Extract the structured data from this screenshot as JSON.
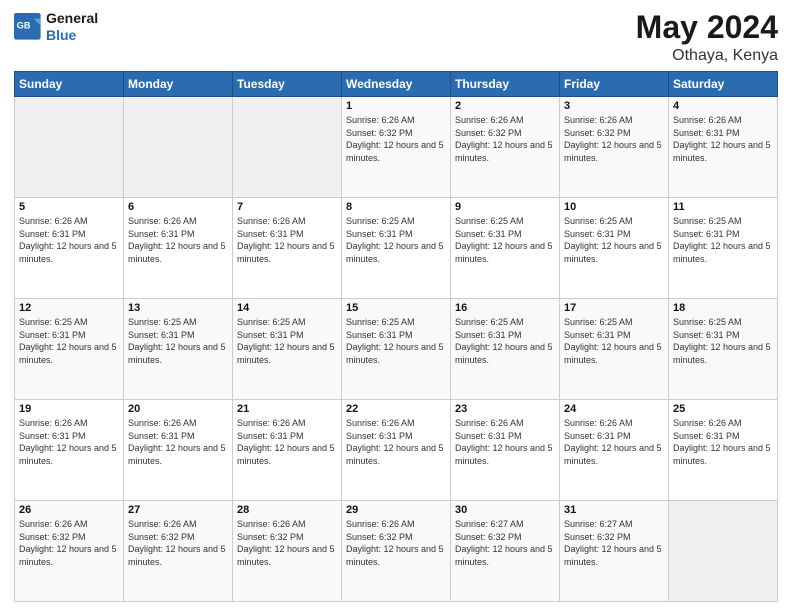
{
  "logo": {
    "text_general": "General",
    "text_blue": "Blue"
  },
  "header": {
    "title": "May 2024",
    "subtitle": "Othaya, Kenya"
  },
  "days_of_week": [
    "Sunday",
    "Monday",
    "Tuesday",
    "Wednesday",
    "Thursday",
    "Friday",
    "Saturday"
  ],
  "weeks": [
    {
      "days": [
        {
          "number": "",
          "empty": true
        },
        {
          "number": "",
          "empty": true
        },
        {
          "number": "",
          "empty": true
        },
        {
          "number": "1",
          "sunrise": "6:26 AM",
          "sunset": "6:32 PM",
          "daylight": "12 hours and 5 minutes."
        },
        {
          "number": "2",
          "sunrise": "6:26 AM",
          "sunset": "6:32 PM",
          "daylight": "12 hours and 5 minutes."
        },
        {
          "number": "3",
          "sunrise": "6:26 AM",
          "sunset": "6:32 PM",
          "daylight": "12 hours and 5 minutes."
        },
        {
          "number": "4",
          "sunrise": "6:26 AM",
          "sunset": "6:31 PM",
          "daylight": "12 hours and 5 minutes."
        }
      ]
    },
    {
      "days": [
        {
          "number": "5",
          "sunrise": "6:26 AM",
          "sunset": "6:31 PM",
          "daylight": "12 hours and 5 minutes."
        },
        {
          "number": "6",
          "sunrise": "6:26 AM",
          "sunset": "6:31 PM",
          "daylight": "12 hours and 5 minutes."
        },
        {
          "number": "7",
          "sunrise": "6:26 AM",
          "sunset": "6:31 PM",
          "daylight": "12 hours and 5 minutes."
        },
        {
          "number": "8",
          "sunrise": "6:25 AM",
          "sunset": "6:31 PM",
          "daylight": "12 hours and 5 minutes."
        },
        {
          "number": "9",
          "sunrise": "6:25 AM",
          "sunset": "6:31 PM",
          "daylight": "12 hours and 5 minutes."
        },
        {
          "number": "10",
          "sunrise": "6:25 AM",
          "sunset": "6:31 PM",
          "daylight": "12 hours and 5 minutes."
        },
        {
          "number": "11",
          "sunrise": "6:25 AM",
          "sunset": "6:31 PM",
          "daylight": "12 hours and 5 minutes."
        }
      ]
    },
    {
      "days": [
        {
          "number": "12",
          "sunrise": "6:25 AM",
          "sunset": "6:31 PM",
          "daylight": "12 hours and 5 minutes."
        },
        {
          "number": "13",
          "sunrise": "6:25 AM",
          "sunset": "6:31 PM",
          "daylight": "12 hours and 5 minutes."
        },
        {
          "number": "14",
          "sunrise": "6:25 AM",
          "sunset": "6:31 PM",
          "daylight": "12 hours and 5 minutes."
        },
        {
          "number": "15",
          "sunrise": "6:25 AM",
          "sunset": "6:31 PM",
          "daylight": "12 hours and 5 minutes."
        },
        {
          "number": "16",
          "sunrise": "6:25 AM",
          "sunset": "6:31 PM",
          "daylight": "12 hours and 5 minutes."
        },
        {
          "number": "17",
          "sunrise": "6:25 AM",
          "sunset": "6:31 PM",
          "daylight": "12 hours and 5 minutes."
        },
        {
          "number": "18",
          "sunrise": "6:25 AM",
          "sunset": "6:31 PM",
          "daylight": "12 hours and 5 minutes."
        }
      ]
    },
    {
      "days": [
        {
          "number": "19",
          "sunrise": "6:26 AM",
          "sunset": "6:31 PM",
          "daylight": "12 hours and 5 minutes."
        },
        {
          "number": "20",
          "sunrise": "6:26 AM",
          "sunset": "6:31 PM",
          "daylight": "12 hours and 5 minutes."
        },
        {
          "number": "21",
          "sunrise": "6:26 AM",
          "sunset": "6:31 PM",
          "daylight": "12 hours and 5 minutes."
        },
        {
          "number": "22",
          "sunrise": "6:26 AM",
          "sunset": "6:31 PM",
          "daylight": "12 hours and 5 minutes."
        },
        {
          "number": "23",
          "sunrise": "6:26 AM",
          "sunset": "6:31 PM",
          "daylight": "12 hours and 5 minutes."
        },
        {
          "number": "24",
          "sunrise": "6:26 AM",
          "sunset": "6:31 PM",
          "daylight": "12 hours and 5 minutes."
        },
        {
          "number": "25",
          "sunrise": "6:26 AM",
          "sunset": "6:31 PM",
          "daylight": "12 hours and 5 minutes."
        }
      ]
    },
    {
      "days": [
        {
          "number": "26",
          "sunrise": "6:26 AM",
          "sunset": "6:32 PM",
          "daylight": "12 hours and 5 minutes."
        },
        {
          "number": "27",
          "sunrise": "6:26 AM",
          "sunset": "6:32 PM",
          "daylight": "12 hours and 5 minutes."
        },
        {
          "number": "28",
          "sunrise": "6:26 AM",
          "sunset": "6:32 PM",
          "daylight": "12 hours and 5 minutes."
        },
        {
          "number": "29",
          "sunrise": "6:26 AM",
          "sunset": "6:32 PM",
          "daylight": "12 hours and 5 minutes."
        },
        {
          "number": "30",
          "sunrise": "6:27 AM",
          "sunset": "6:32 PM",
          "daylight": "12 hours and 5 minutes."
        },
        {
          "number": "31",
          "sunrise": "6:27 AM",
          "sunset": "6:32 PM",
          "daylight": "12 hours and 5 minutes."
        },
        {
          "number": "",
          "empty": true
        }
      ]
    }
  ],
  "labels": {
    "sunrise_prefix": "Sunrise: ",
    "sunset_prefix": "Sunset: ",
    "daylight_prefix": "Daylight: "
  }
}
